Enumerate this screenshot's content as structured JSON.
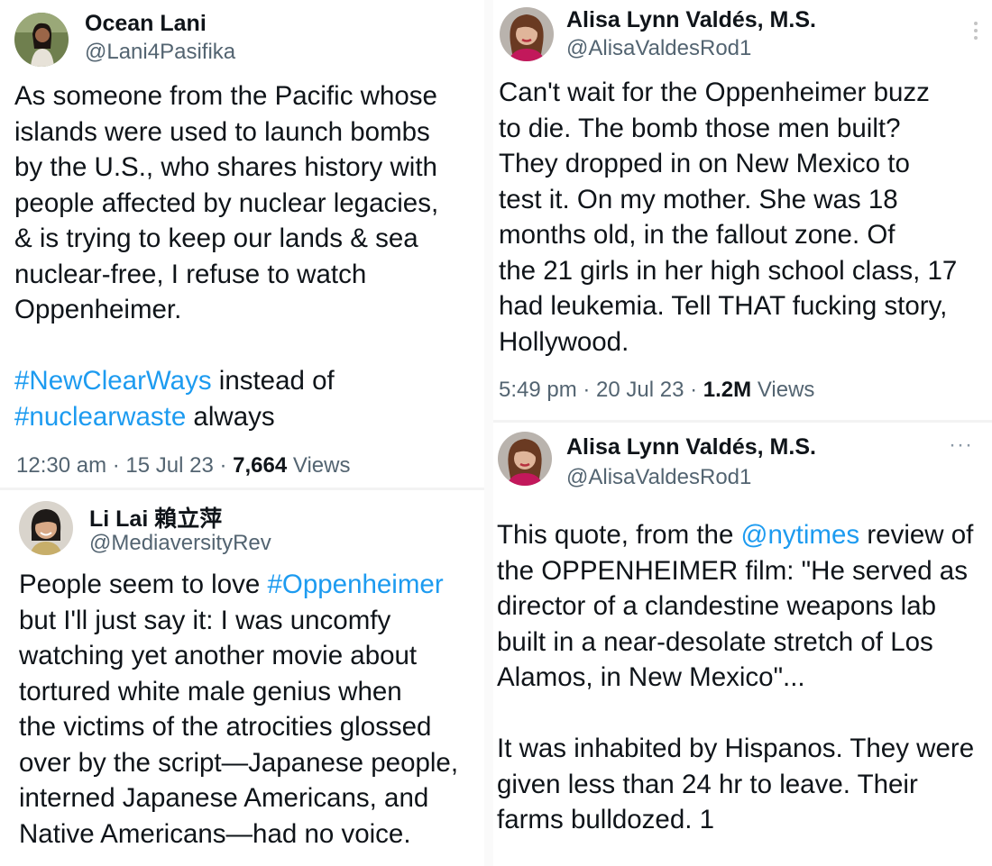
{
  "tweets": [
    {
      "name": "Ocean Lani",
      "handle": "@Lani4Pasifika",
      "lines": [
        [
          {
            "t": "As someone from the Pacific whose"
          }
        ],
        [
          {
            "t": "islands were used to launch bombs"
          }
        ],
        [
          {
            "t": "by the U.S., who shares history with"
          }
        ],
        [
          {
            "t": "people affected by nuclear legacies,"
          }
        ],
        [
          {
            "t": "& is trying to keep our lands & sea"
          }
        ],
        [
          {
            "t": "nuclear-free, I refuse to watch"
          }
        ],
        [
          {
            "t": "Oppenheimer."
          }
        ],
        [],
        [
          {
            "t": "#NewClearWays",
            "h": true
          },
          {
            "t": " instead of"
          }
        ],
        [
          {
            "t": "#nuclearwaste",
            "h": true
          },
          {
            "t": " always"
          }
        ]
      ],
      "time": "12:30 am",
      "date": "15 Jul 23",
      "views_count": "7,664",
      "views_label": "Views"
    },
    {
      "name": "Li Lai 賴立萍",
      "handle": "@MediaversityRev",
      "lines": [
        [
          {
            "t": "People seem to love "
          },
          {
            "t": "#Oppenheimer",
            "h": true
          }
        ],
        [
          {
            "t": "but I'll just say it: I was uncomfy"
          }
        ],
        [
          {
            "t": "watching yet another movie about"
          }
        ],
        [
          {
            "t": "tortured white male genius when"
          }
        ],
        [
          {
            "t": "the victims of the atrocities glossed"
          }
        ],
        [
          {
            "t": "over by the script—Japanese people,"
          }
        ],
        [
          {
            "t": "interned Japanese Americans, and"
          }
        ],
        [
          {
            "t": "Native Americans—had no voice."
          }
        ]
      ]
    },
    {
      "name": "Alisa Lynn Valdés, M.S.",
      "handle": "@AlisaValdesRod1",
      "lines": [
        [
          {
            "t": "Can't wait for the Oppenheimer buzz"
          }
        ],
        [
          {
            "t": "to die. The bomb those men built?"
          }
        ],
        [
          {
            "t": "They dropped in on New Mexico to"
          }
        ],
        [
          {
            "t": "test it. On my mother. She was 18"
          }
        ],
        [
          {
            "t": "months old, in the fallout zone. Of"
          }
        ],
        [
          {
            "t": "the 21 girls in her high school class, 17"
          }
        ],
        [
          {
            "t": "had leukemia. Tell THAT fucking story,"
          }
        ],
        [
          {
            "t": "Hollywood."
          }
        ]
      ],
      "time": "5:49 pm",
      "date": "20 Jul 23",
      "views_count": "1.2M",
      "views_label": "Views"
    },
    {
      "name": "Alisa Lynn Valdés, M.S.",
      "handle": "@AlisaValdesRod1",
      "more": "···",
      "lines": [
        [
          {
            "t": "This quote, from the "
          },
          {
            "t": "@nytimes",
            "m": true
          },
          {
            "t": " review of"
          }
        ],
        [
          {
            "t": "the OPPENHEIMER film: \"He served as"
          }
        ],
        [
          {
            "t": "director of a clandestine weapons lab"
          }
        ],
        [
          {
            "t": "built in a near-desolate stretch of Los"
          }
        ],
        [
          {
            "t": "Alamos, in New Mexico\"..."
          }
        ],
        [],
        [
          {
            "t": "It was inhabited by Hispanos. They were"
          }
        ],
        [
          {
            "t": "given less than 24 hr to leave. Their"
          }
        ],
        [
          {
            "t": "farms bulldozed. 1"
          }
        ]
      ]
    }
  ],
  "sep": " · ",
  "colors": {
    "link": "#1d9bf0",
    "secondary": "#536471",
    "text": "#0f1419"
  }
}
